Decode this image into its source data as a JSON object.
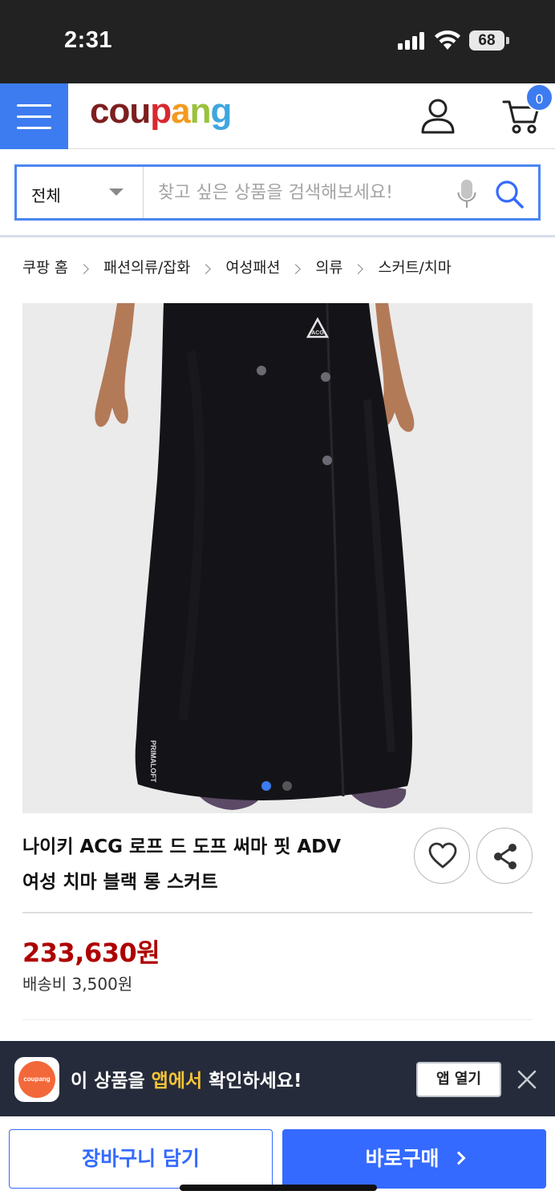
{
  "status_bar": {
    "time": "2:31",
    "battery": "68"
  },
  "header": {
    "logo_letters": [
      {
        "char": "c",
        "color": "#7d1f1f"
      },
      {
        "char": "o",
        "color": "#7d1f1f"
      },
      {
        "char": "u",
        "color": "#7d1f1f"
      },
      {
        "char": "p",
        "color": "#d7282f"
      },
      {
        "char": "a",
        "color": "#f39a1f"
      },
      {
        "char": "n",
        "color": "#9bc23c"
      },
      {
        "char": "g",
        "color": "#3ea6de"
      }
    ],
    "cart_count": "0"
  },
  "search": {
    "category": "전체",
    "placeholder": "찾고 싶은 상품을 검색해보세요!"
  },
  "breadcrumb": [
    "쿠팡 홈",
    "패션의류/잡화",
    "여성패션",
    "의류",
    "스커트/치마"
  ],
  "product": {
    "title_line1": "나이키 ACG 로프 드 도프 써마 핏 ADV",
    "title_line2": "여성 치마 블랙 롱 스커트",
    "price": "233,630원",
    "shipping": "배송비 3,500원",
    "image_alt_icon": "product-photo-skirt",
    "brand_logo_text": "ACG",
    "fabric_label": "PRIMALOFT",
    "image_count": 2,
    "current_image": 1
  },
  "app_banner": {
    "text_before": "이 상품을 ",
    "text_highlight": "앱에서",
    "text_after": " 확인하세요!",
    "logo_text": "coupang",
    "open_label": "앱 열기"
  },
  "actions": {
    "cart_label": "장바구니 담기",
    "buy_label": "바로구매"
  },
  "colors": {
    "accent": "#346aff",
    "price": "#ae0000",
    "banner_bg": "#252b3a",
    "highlight": "#f5c338"
  }
}
